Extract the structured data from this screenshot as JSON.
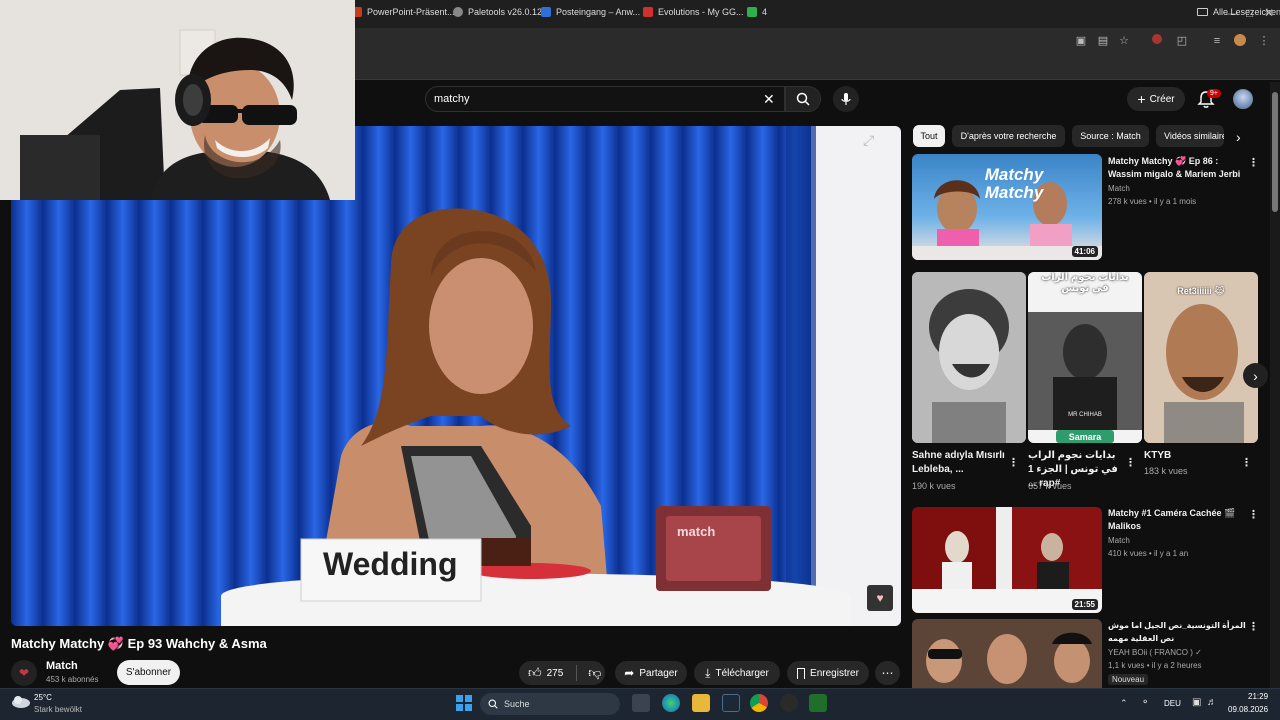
{
  "browser": {
    "bookmarks": [
      {
        "label": "PowerPoint-Präsent...",
        "color": "#c43e1c"
      },
      {
        "label": "Paletools v26.0.12",
        "color": "#888888"
      },
      {
        "label": "Posteingang – Anw...",
        "color": "#2f6fd6"
      },
      {
        "label": "Evolutions - My GG...",
        "color": "#d0312d"
      },
      {
        "label": "4",
        "color": "#2bb24c"
      }
    ],
    "all_bookmarks": "Alle Lesezeichen"
  },
  "header": {
    "search_value": "matchy",
    "create_label": "Créer",
    "notif_count": "9+"
  },
  "video": {
    "title": "Matchy Matchy 💞 Ep 93 Wahchy & Asma",
    "placard_text": "Wedding",
    "box_text": "match",
    "channel_name": "Match",
    "channel_subs": "453 k abonnés",
    "subscribe_label": "S'abonner",
    "likes": "275",
    "share_label": "Partager",
    "download_label": "Télécharger",
    "save_label": "Enregistrer"
  },
  "chips": [
    "Tout",
    "D'après votre recherche",
    "Source : Match",
    "Vidéos similaires"
  ],
  "sidebar": {
    "videos": [
      {
        "title": "Matchy Matchy 💞 Ep 86 : Wassim migalo & Mariem Jerbi",
        "channel": "Match",
        "meta": "278 k vues • il y a 1 mois",
        "duration": "41:06",
        "thumb_text": "Matchy Matchy"
      },
      {
        "title": "Matchy #1 Caméra Cachée 🎬 Malikos",
        "channel": "Match",
        "meta": "410 k vues • il y a 1 an",
        "duration": "21:55",
        "thumb_text": ""
      },
      {
        "title": "المرأة التونسية_نص الجيل اما موش نص العقلية مهمه",
        "channel": "YEAH BOii ( FRANCO ) ✓",
        "meta": "1,1 k vues • il y a 2 heures",
        "badge": "Nouveau"
      }
    ],
    "shorts": [
      {
        "title": "Sahne adıyla Mısırlı Lebleba, ...",
        "views": "190 k vues"
      },
      {
        "title": "بدايات نجوم الراب في تونس | الجزء 1 #rap ...",
        "views": "657 k vues",
        "overlay_top": "بدايات نجوم الراب في تونس",
        "overlay_mid": "MR CHIHAB",
        "overlay_bottom": "Samara"
      },
      {
        "title": "KTYB",
        "views": "183 k vues",
        "overlay_top": "Ret3iiiiii 😹"
      }
    ]
  },
  "taskbar": {
    "weather_temp": "25°C",
    "weather_desc": "Stark bewölkt",
    "search_label": "Suche",
    "lang": "DEU",
    "time": "21:29",
    "date": "09.08.2026"
  }
}
